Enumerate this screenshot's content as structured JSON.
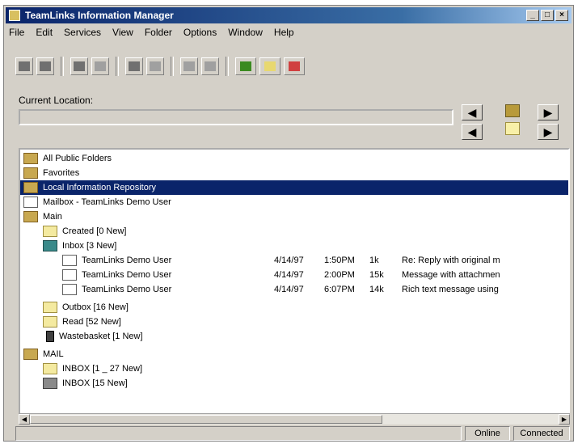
{
  "window": {
    "title": "TeamLinks Information Manager",
    "controls": [
      "_",
      "□",
      "×"
    ]
  },
  "menu": [
    "File",
    "Edit",
    "Services",
    "View",
    "Folder",
    "Options",
    "Window",
    "Help"
  ],
  "toolbar": {
    "icons": [
      "print-icon",
      "open-icon",
      "new-icon",
      "properties-icon",
      "copy-icon",
      "cut-icon",
      "delete-icon",
      "find-icon"
    ],
    "color_icons": [
      "green-folder-icon",
      "yellow-folder-icon",
      "red-folder-icon"
    ]
  },
  "location": {
    "label": "Current Location:",
    "value": ""
  },
  "tree": {
    "items": [
      {
        "label": "All Public Folders",
        "icon": "folder",
        "indent": 0
      },
      {
        "label": "Favorites",
        "icon": "folder",
        "indent": 0
      },
      {
        "label": "Local Information Repository",
        "icon": "folder",
        "indent": 0,
        "selected": true
      },
      {
        "label": "Mailbox - TeamLinks Demo User",
        "icon": "mail",
        "indent": 0
      },
      {
        "label": "Main",
        "icon": "folder",
        "indent": 0
      },
      {
        "label": "Created [0 New]",
        "icon": "lfolder",
        "indent": 1
      },
      {
        "label": "Inbox [3 New]",
        "icon": "inbox",
        "indent": 1
      },
      {
        "label": "Outbox [16 New]",
        "icon": "lfolder",
        "indent": 1
      },
      {
        "label": "Read [52 New]",
        "icon": "lfolder",
        "indent": 1
      },
      {
        "label": "Wastebasket [1 New]",
        "icon": "doc",
        "indent": 1
      },
      {
        "label": "MAIL",
        "icon": "folder",
        "indent": 0
      },
      {
        "label": "INBOX [1 _ 27 New]",
        "icon": "lfolder",
        "indent": 1
      },
      {
        "label": "INBOX [15 New]",
        "icon": "grey",
        "indent": 1
      }
    ],
    "messages": [
      {
        "from": "TeamLinks Demo User",
        "date": "4/14/97",
        "time": "1:50PM",
        "size": "1k",
        "subject": "Re: Reply with original m"
      },
      {
        "from": "TeamLinks Demo User",
        "date": "4/14/97",
        "time": "2:00PM",
        "size": "15k",
        "subject": "Message with attachmen"
      },
      {
        "from": "TeamLinks Demo User",
        "date": "4/14/97",
        "time": "6:07PM",
        "size": "14k",
        "subject": "Rich text message using"
      }
    ]
  },
  "status": {
    "main": "",
    "panel1": "Online",
    "panel2": "Connected"
  },
  "colors": {
    "title_bar": "#0a246a",
    "selection": "#0a246a",
    "face": "#d4d0c8"
  }
}
